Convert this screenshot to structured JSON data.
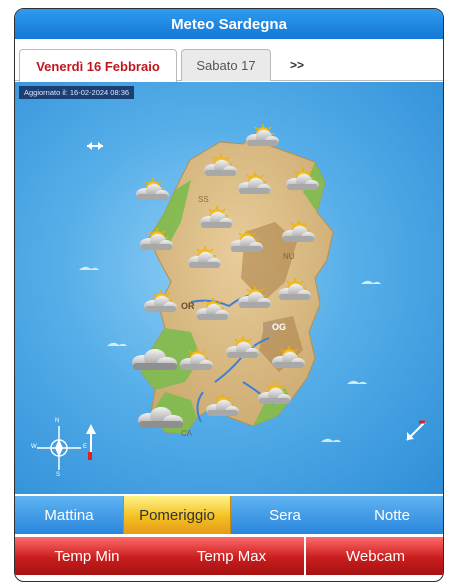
{
  "header": {
    "title": "Meteo Sardegna"
  },
  "tabs": [
    {
      "label": "Venerdì 16 Febbraio",
      "active": true
    },
    {
      "label": "Sabato 17",
      "active": false
    },
    {
      "label": ">>",
      "active": false
    }
  ],
  "map": {
    "updated": "Aggiornato il: 16-02-2024 08:36",
    "labels": [
      "OR",
      "OG",
      "SS",
      "NU",
      "CA"
    ],
    "weather_icon": "cloud-sun-icon",
    "heavy_cloud_icon": "cloud-icon",
    "wind_icon": "wind-arrow-icon",
    "compass": {
      "n": "N",
      "s": "S",
      "e": "E",
      "w": "W"
    }
  },
  "time_periods": [
    {
      "label": "Mattina",
      "selected": false
    },
    {
      "label": "Pomeriggio",
      "selected": true
    },
    {
      "label": "Sera",
      "selected": false
    },
    {
      "label": "Notte",
      "selected": false
    }
  ],
  "bottom_buttons": [
    {
      "label": "Temp Min"
    },
    {
      "label": "Temp Max"
    },
    {
      "label": "Webcam"
    }
  ],
  "colors": {
    "title_blue": "#1a86e6",
    "active_tab_red": "#c0171f",
    "selected_period": "#f3c021",
    "bottom_red": "#c91d1d"
  }
}
